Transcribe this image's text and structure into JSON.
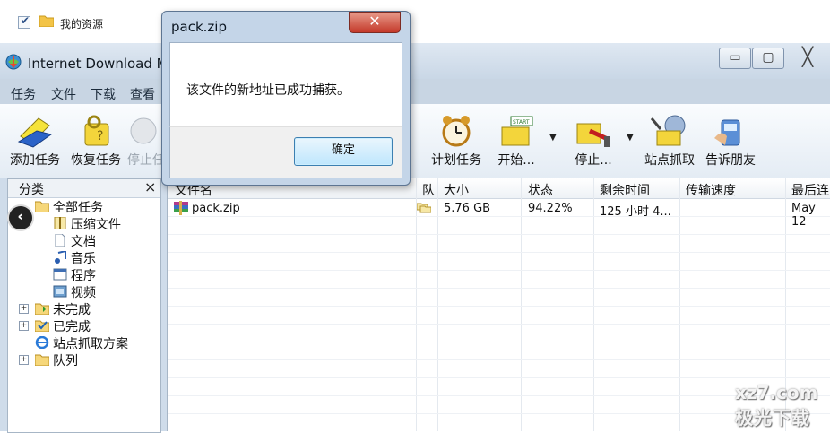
{
  "top": {
    "text": "我的资源",
    "checked": true
  },
  "window": {
    "title": "Internet Download M",
    "controls": {
      "minimize": "▭",
      "maximize": "▢",
      "close": "╳"
    }
  },
  "menu": [
    "任务",
    "文件",
    "下载",
    "查看"
  ],
  "toolbar": {
    "add": "添加任务",
    "resume": "恢复任务",
    "stop": "停止任",
    "schedule": "计划任务",
    "start": "开始...",
    "stopq": "停止...",
    "grabber": "站点抓取",
    "tell": "告诉朋友",
    "start_badge": "START"
  },
  "sidebar": {
    "title": "分类",
    "close": "×",
    "items": [
      {
        "label": "全部任务",
        "icon": "folder-open-icon"
      },
      {
        "label": "压缩文件",
        "icon": "zip-icon"
      },
      {
        "label": "文档",
        "icon": "document-icon"
      },
      {
        "label": "音乐",
        "icon": "music-icon"
      },
      {
        "label": "程序",
        "icon": "program-icon"
      },
      {
        "label": "视频",
        "icon": "video-icon"
      },
      {
        "label": "未完成",
        "icon": "unfinished-icon"
      },
      {
        "label": "已完成",
        "icon": "finished-icon"
      },
      {
        "label": "站点抓取方案",
        "icon": "ie-icon"
      },
      {
        "label": "队列",
        "icon": "queue-icon"
      }
    ]
  },
  "list": {
    "columns": [
      "文件名",
      "队",
      "大小",
      "状态",
      "剩余时间",
      "传输速度",
      "最后连"
    ],
    "rows": [
      {
        "name": "pack.zip",
        "size": "5.76  GB",
        "status": "94.22%",
        "remaining": "125 小时 4...",
        "speed": "",
        "last": "May 12"
      }
    ]
  },
  "dialog": {
    "title": "pack.zip",
    "message": "该文件的新地址已成功捕获。",
    "ok": "确定",
    "close": "✕"
  },
  "watermark": {
    "line1": "xz7.com",
    "line2": "极光下载"
  },
  "back_glyph": "‹"
}
